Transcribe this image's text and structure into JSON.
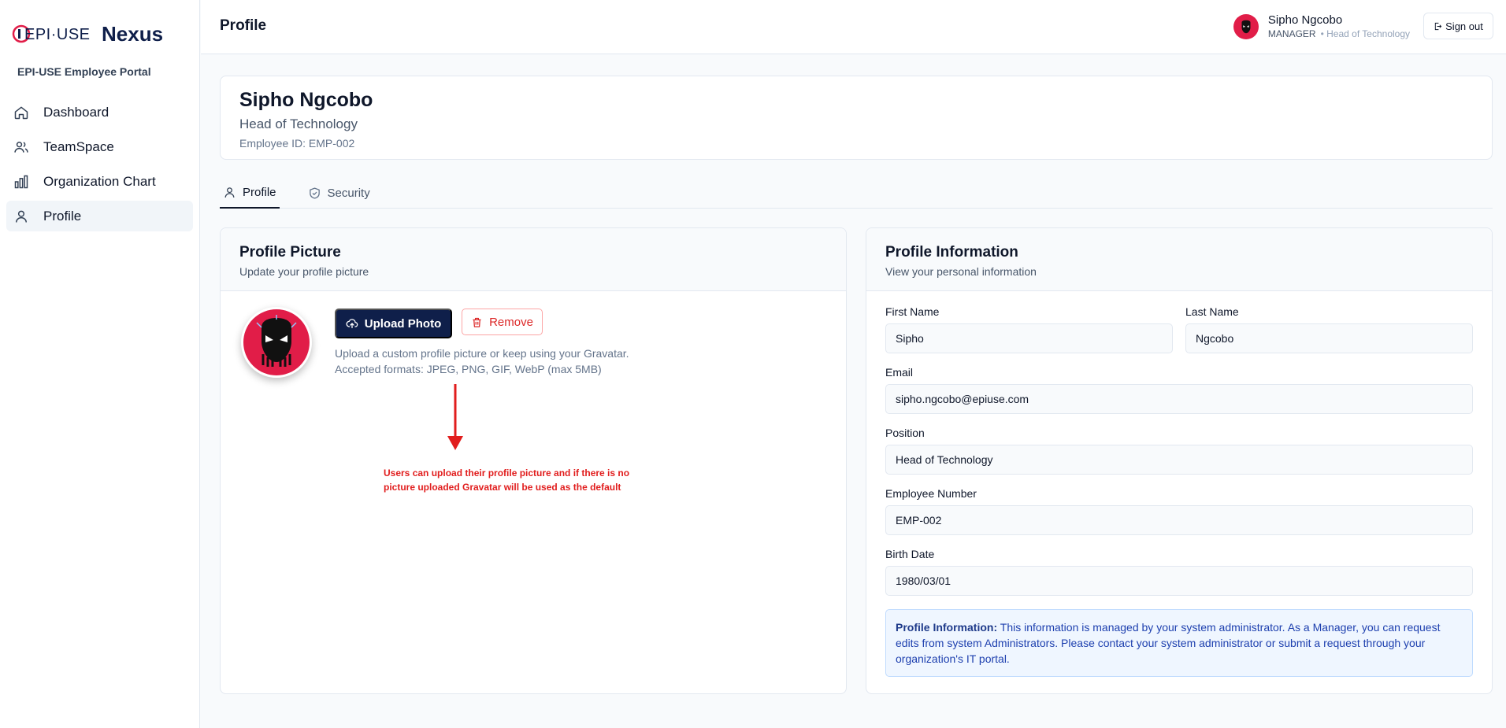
{
  "brand": {
    "logo_text": "EPI·USE",
    "app_name": "Nexus",
    "portal_name": "EPI-USE Employee Portal"
  },
  "sidebar": {
    "items": [
      {
        "label": "Dashboard",
        "icon": "home-icon"
      },
      {
        "label": "TeamSpace",
        "icon": "users-icon"
      },
      {
        "label": "Organization Chart",
        "icon": "bar-chart-icon"
      },
      {
        "label": "Profile",
        "icon": "user-icon",
        "active": true
      }
    ]
  },
  "header": {
    "title": "Profile",
    "user_name": "Sipho Ngcobo",
    "user_role": "MANAGER",
    "user_title": "• Head of Technology",
    "signout_label": "Sign out"
  },
  "employee": {
    "name": "Sipho Ngcobo",
    "position": "Head of Technology",
    "id_text": "Employee ID: EMP-002"
  },
  "tabs": [
    {
      "label": "Profile",
      "icon": "user-icon",
      "active": true
    },
    {
      "label": "Security",
      "icon": "shield-icon",
      "active": false
    }
  ],
  "picture_card": {
    "title": "Profile Picture",
    "description": "Update your profile picture",
    "upload_label": "Upload Photo",
    "remove_label": "Remove",
    "help_line1": "Upload a custom profile picture or keep using your Gravatar.",
    "help_line2": "Accepted formats: JPEG, PNG, GIF, WebP (max 5MB)",
    "annotation": "Users can upload their profile picture and if there is no picture uploaded Gravatar will be used as the default"
  },
  "info_card": {
    "title": "Profile Information",
    "description": "View your personal information",
    "fields": {
      "first_name": {
        "label": "First Name",
        "value": "Sipho"
      },
      "last_name": {
        "label": "Last Name",
        "value": "Ngcobo"
      },
      "email": {
        "label": "Email",
        "value": "sipho.ngcobo@epiuse.com"
      },
      "position": {
        "label": "Position",
        "value": "Head of Technology"
      },
      "employee_number": {
        "label": "Employee Number",
        "value": "EMP-002"
      },
      "birth_date": {
        "label": "Birth Date",
        "value": "1980/03/01"
      }
    },
    "notice_bold": "Profile Information:",
    "notice_text": " This information is managed by your system administrator. As a Manager, you can request edits from system Administrators. Please contact your system administrator or submit a request through your organization's IT portal."
  },
  "colors": {
    "brand_navy": "#0f1f4a",
    "avatar_red": "#e11d48",
    "danger": "#dc2626",
    "annotation_red": "#e11d1d",
    "notice_bg": "#eff6ff"
  }
}
